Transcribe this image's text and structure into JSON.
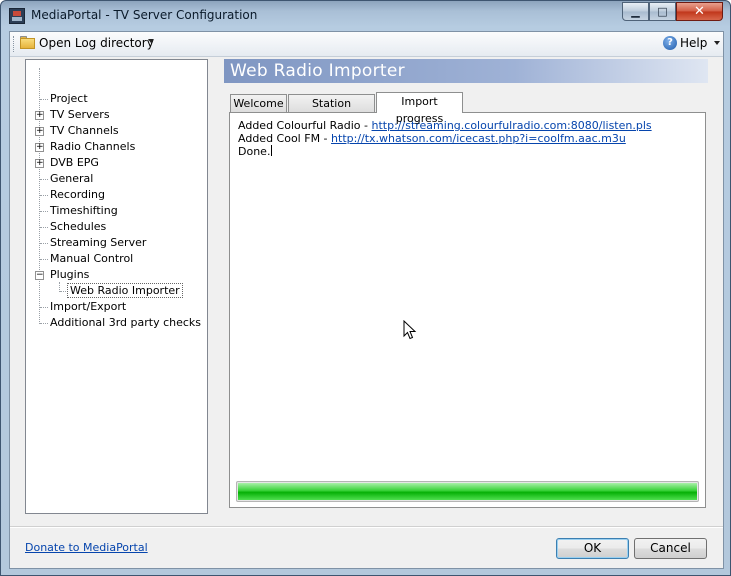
{
  "window": {
    "title": "MediaPortal - TV Server Configuration",
    "controls": {
      "minimize": "▁",
      "maximize": "□",
      "close": "✕"
    }
  },
  "toolbar": {
    "open_log_label": "Open Log directory",
    "help_label": "Help",
    "help_glyph": "?"
  },
  "tree": {
    "items": [
      {
        "label": "Project"
      },
      {
        "label": "TV Servers"
      },
      {
        "label": "TV Channels"
      },
      {
        "label": "Radio Channels"
      },
      {
        "label": "DVB EPG"
      },
      {
        "label": "General"
      },
      {
        "label": "Recording"
      },
      {
        "label": "Timeshifting"
      },
      {
        "label": "Schedules"
      },
      {
        "label": "Streaming Server"
      },
      {
        "label": "Manual Control"
      },
      {
        "label": "Plugins"
      },
      {
        "label": "Web Radio Importer"
      },
      {
        "label": "Import/Export"
      },
      {
        "label": "Additional 3rd party checks"
      }
    ],
    "expanders": {
      "plus": "+",
      "minus": "−"
    }
  },
  "panel": {
    "title": "Web Radio Importer",
    "tabs": [
      {
        "label": "Welcome"
      },
      {
        "label": "Station selection"
      },
      {
        "label": "Import progress"
      }
    ],
    "log": [
      {
        "prefix": "Added Colourful Radio - ",
        "link": "http://streaming.colourfulradio.com:8080/listen.pls"
      },
      {
        "prefix": "Added Cool FM - ",
        "link": "http://tx.whatson.com/icecast.php?i=coolfm.aac.m3u"
      },
      {
        "prefix": "Done.",
        "link": ""
      }
    ],
    "progress_percent": 100
  },
  "footer": {
    "donate_label": "Donate to MediaPortal",
    "ok_label": "OK",
    "cancel_label": "Cancel"
  },
  "colors": {
    "header_gradient_start": "#7f96c2",
    "progress_green": "#06b006",
    "link": "#0645ad"
  }
}
